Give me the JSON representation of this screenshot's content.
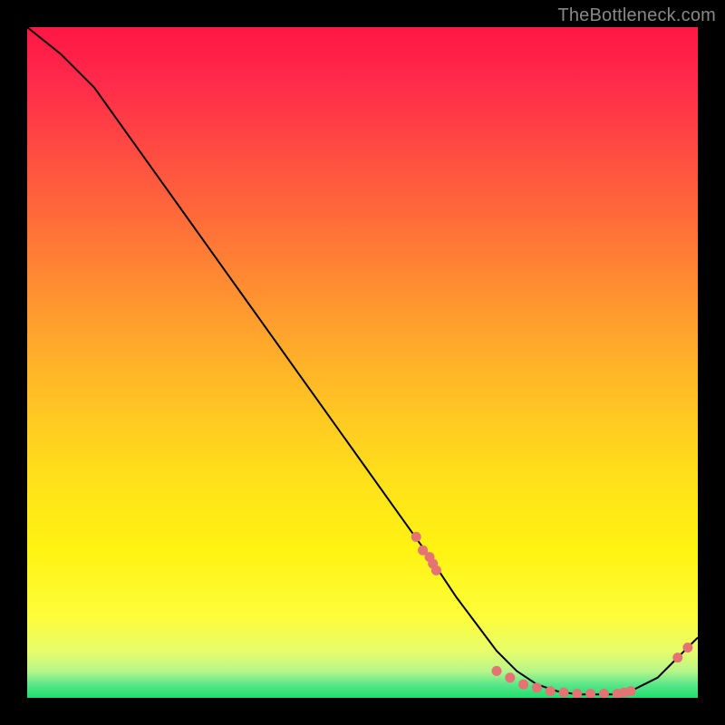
{
  "watermark": "TheBottleneck.com",
  "chart_data": {
    "type": "line",
    "title": "",
    "xlabel": "",
    "ylabel": "",
    "xlim": [
      0,
      100
    ],
    "ylim": [
      0,
      100
    ],
    "grid": false,
    "legend": false,
    "x": [
      0,
      5,
      10,
      15,
      20,
      25,
      30,
      35,
      40,
      45,
      50,
      55,
      60,
      62,
      64,
      67,
      70,
      73,
      76,
      79,
      82,
      85,
      88,
      90,
      92,
      94,
      96,
      98,
      100
    ],
    "values": [
      100,
      96,
      91,
      84,
      77,
      70,
      63,
      56,
      49,
      42,
      35,
      28,
      21,
      18,
      15,
      11,
      7,
      4,
      2,
      1,
      0.5,
      0.5,
      0.5,
      1,
      2,
      3,
      5,
      7,
      9
    ],
    "markers_x": [
      58,
      59,
      60,
      60.5,
      61,
      70,
      72,
      74,
      76,
      78,
      80,
      82,
      84,
      86,
      88,
      89,
      90,
      97,
      98.5
    ],
    "markers_y": [
      24,
      22,
      21,
      20,
      19,
      4,
      3,
      2,
      1.5,
      1,
      0.8,
      0.6,
      0.6,
      0.6,
      0.6,
      0.8,
      1,
      6,
      7.5
    ],
    "marker_color": "#e57373",
    "line_color": "#000000"
  }
}
